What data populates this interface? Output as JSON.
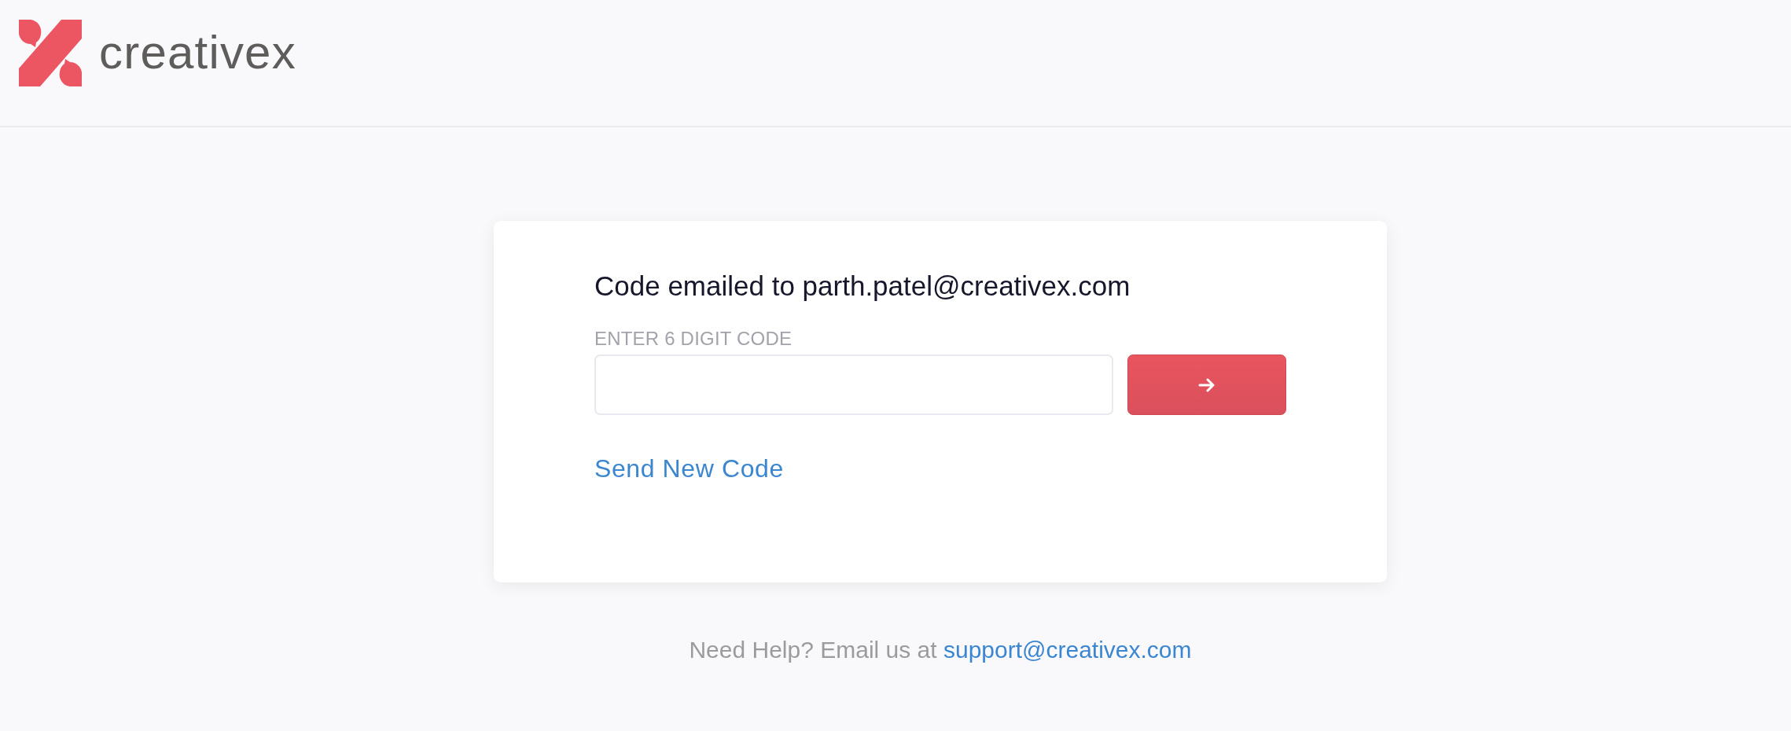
{
  "header": {
    "logo": {
      "wordmark": "creativex"
    }
  },
  "card": {
    "heading": "Code emailed to parth.patel@creativex.com",
    "code_field": {
      "label": "ENTER 6 DIGIT CODE"
    },
    "resend_link": "Send New Code"
  },
  "footer": {
    "help_text": "Need Help? Email us at",
    "email_link": "support@creativex.com"
  }
}
